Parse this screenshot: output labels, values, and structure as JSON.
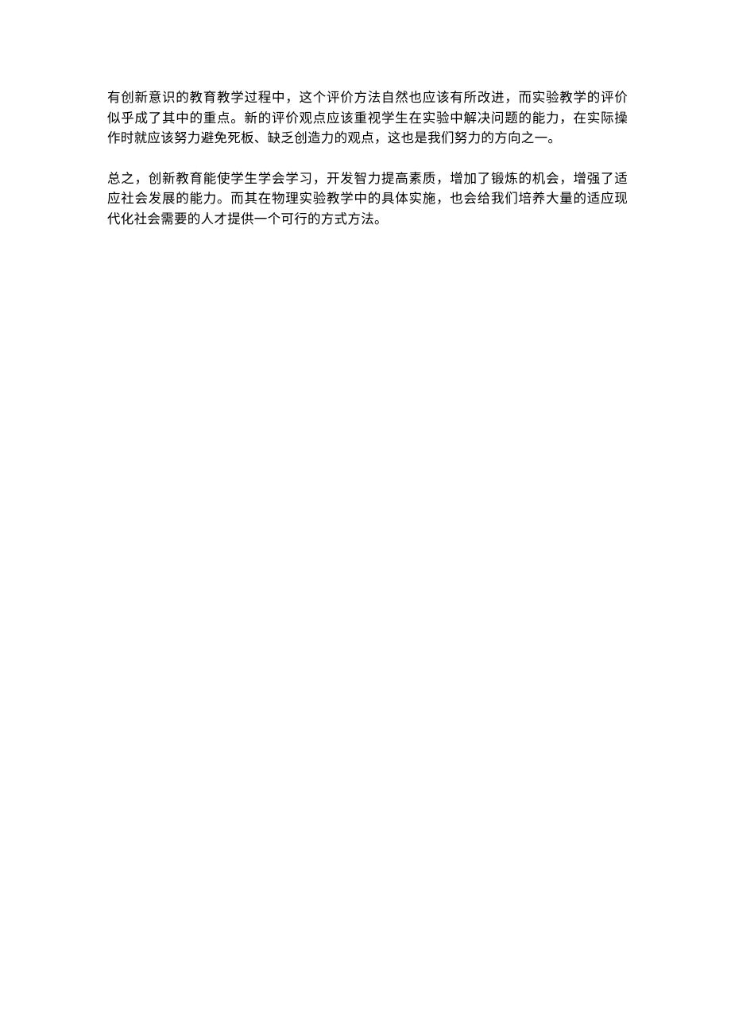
{
  "paragraphs": {
    "p1": "有创新意识的教育教学过程中，这个评价方法自然也应该有所改进，而实验教学的评价似乎成了其中的重点。新的评价观点应该重视学生在实验中解决问题的能力，在实际操作时就应该努力避免死板、缺乏创造力的观点，这也是我们努力的方向之一。",
    "p2": "总之，创新教育能使学生学会学习，开发智力提高素质，增加了锻炼的机会，增强了适应社会发展的能力。而其在物理实验教学中的具体实施，也会给我们培养大量的适应现代化社会需要的人才提供一个可行的方式方法。"
  }
}
